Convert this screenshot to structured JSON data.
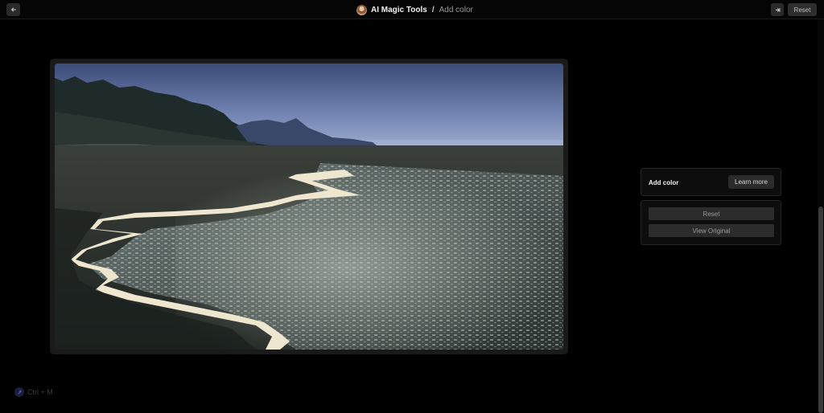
{
  "header": {
    "tool_name": "AI Magic Tools",
    "separator": "/",
    "page_name": "Add color",
    "reset_label": "Reset",
    "back_icon": "arrow-left-icon",
    "expand_icon": "expand-icon"
  },
  "panel": {
    "title": "Add color",
    "learn_more_label": "Learn more",
    "reset_label": "Reset",
    "view_original_label": "View Original"
  },
  "shortcut": {
    "label": "Ctrl + M",
    "icon": "magic-icon"
  },
  "colors": {
    "background": "#000000",
    "panel": "#0d0d0d",
    "button": "#2c2c2c"
  }
}
